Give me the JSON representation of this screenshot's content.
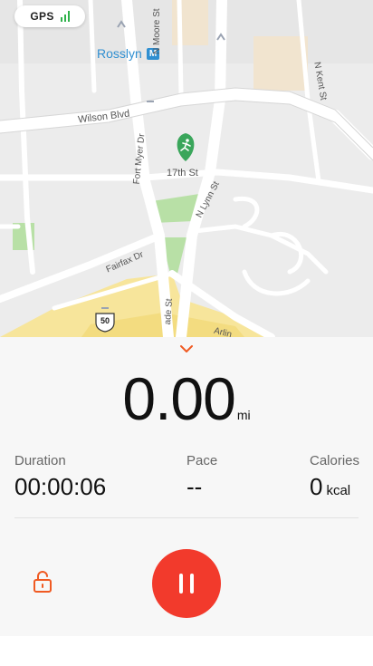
{
  "status": {
    "gps_label": "GPS",
    "gps_signal_color": "#2fb24b"
  },
  "map": {
    "labels": {
      "rosslyn": "Rosslyn",
      "metro_badge": "M",
      "wilson_blvd": "Wilson Blvd",
      "n_moore_st": "N Moore St",
      "n_kent_st": "N Kent St",
      "fort_myer_dr": "Fort Myer Dr",
      "seventeenth_st": "17th St",
      "n_lynn_st": "N Lynn St",
      "fairfax_dr": "Fairfax Dr",
      "us_50": "50",
      "arlington_partial": "Arlin",
      "ade_st_partial": "ade St"
    },
    "marker_icon": "running-person-icon",
    "colors": {
      "metro_blue": "#2f8fd1",
      "park_green": "#b8e0a6",
      "highway_yellow": "#f7e59b",
      "marker_green": "#3aa65b"
    }
  },
  "workout": {
    "collapse_icon": "chevron-down-icon",
    "distance_value": "0.00",
    "distance_unit": "mi",
    "stats": {
      "duration": {
        "label": "Duration",
        "value": "00:00:06"
      },
      "pace": {
        "label": "Pace",
        "value": "--"
      },
      "calories": {
        "label": "Calories",
        "value": "0",
        "unit": "kcal"
      }
    }
  },
  "controls": {
    "lock_icon": "lock-open-icon",
    "pause_icon": "pause-icon",
    "accent_color": "#f05a22",
    "pause_color": "#f23a2c"
  }
}
